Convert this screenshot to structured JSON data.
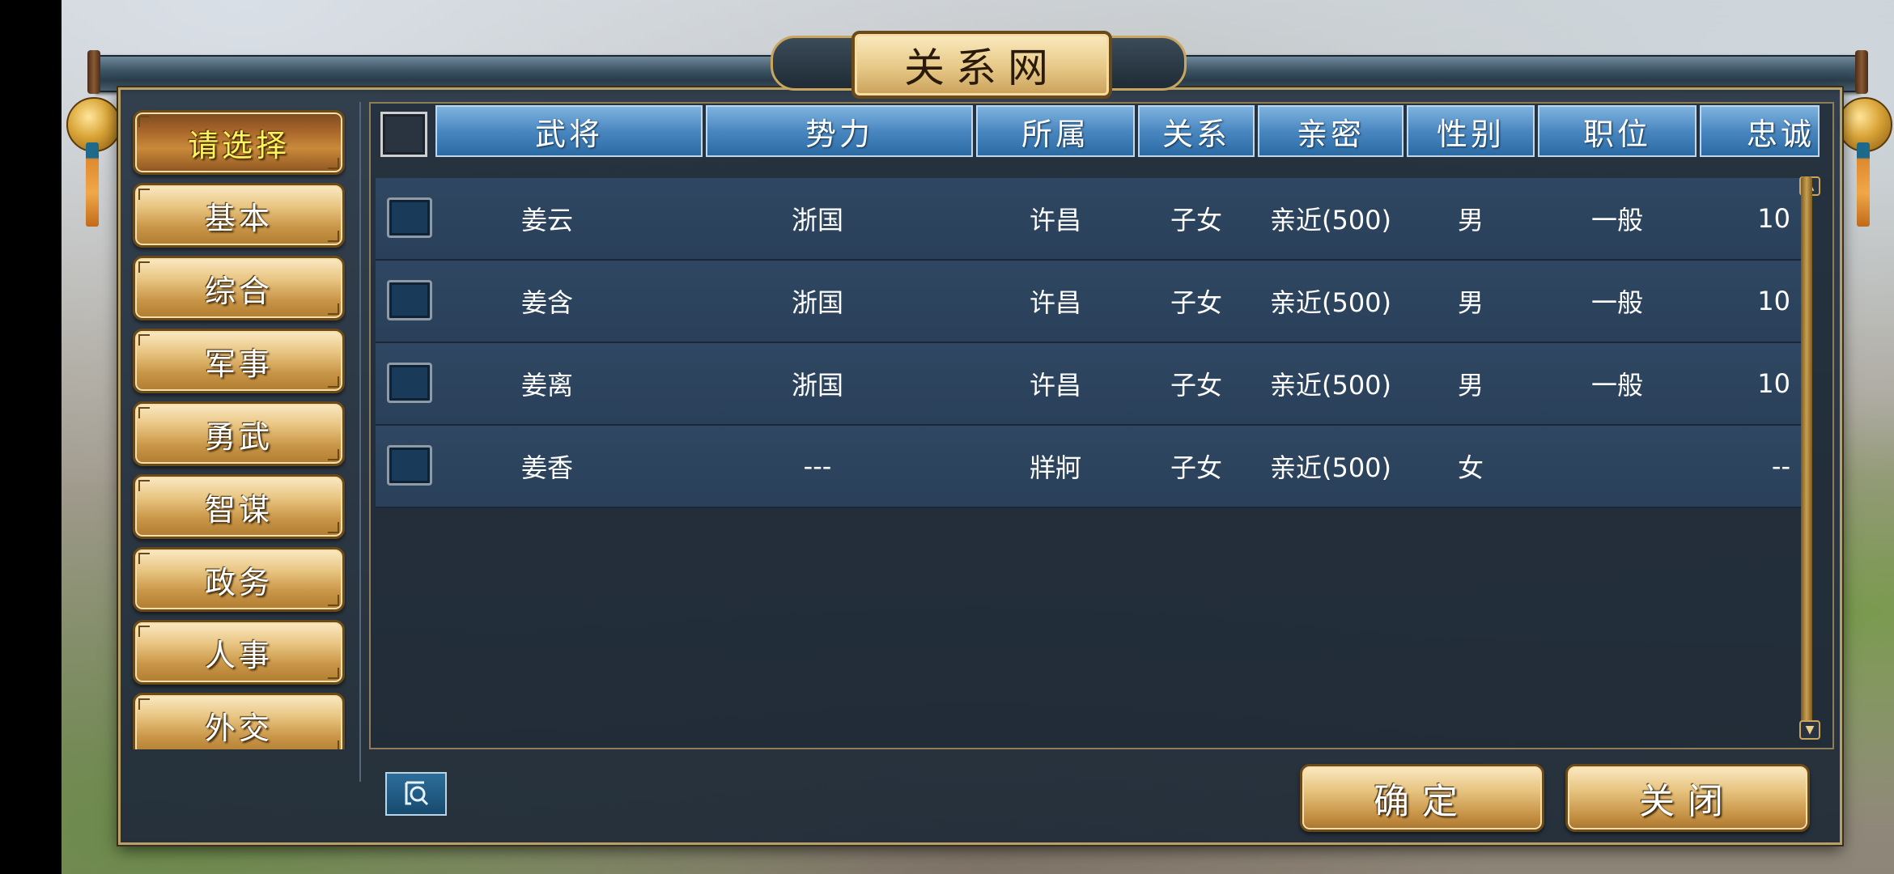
{
  "dialog": {
    "title": "关系网"
  },
  "sidebar": {
    "items": [
      {
        "label": "请选择",
        "active": true
      },
      {
        "label": "基本"
      },
      {
        "label": "综合"
      },
      {
        "label": "军事"
      },
      {
        "label": "勇武"
      },
      {
        "label": "智谋"
      },
      {
        "label": "政务"
      },
      {
        "label": "人事"
      },
      {
        "label": "外交"
      }
    ]
  },
  "table": {
    "columns": [
      "武将",
      "势力",
      "所属",
      "关系",
      "亲密",
      "性别",
      "职位",
      "忠诚"
    ],
    "rows": [
      {
        "name": "姜云",
        "faction": "浙国",
        "city": "许昌",
        "relation": "子女",
        "intimacy": "亲近(500)",
        "gender": "男",
        "post": "一般",
        "loyalty": "10"
      },
      {
        "name": "姜含",
        "faction": "浙国",
        "city": "许昌",
        "relation": "子女",
        "intimacy": "亲近(500)",
        "gender": "男",
        "post": "一般",
        "loyalty": "10"
      },
      {
        "name": "姜离",
        "faction": "浙国",
        "city": "许昌",
        "relation": "子女",
        "intimacy": "亲近(500)",
        "gender": "男",
        "post": "一般",
        "loyalty": "10"
      },
      {
        "name": "姜香",
        "faction": "---",
        "city": "牂牁",
        "relation": "子女",
        "intimacy": "亲近(500)",
        "gender": "女",
        "post": "",
        "loyalty": "--"
      }
    ]
  },
  "footer": {
    "confirm_label": "确定",
    "close_label": "关闭"
  },
  "icons": {
    "search": "search-icon",
    "scroll_up": "arrow-up-icon",
    "scroll_down": "arrow-down-icon"
  }
}
